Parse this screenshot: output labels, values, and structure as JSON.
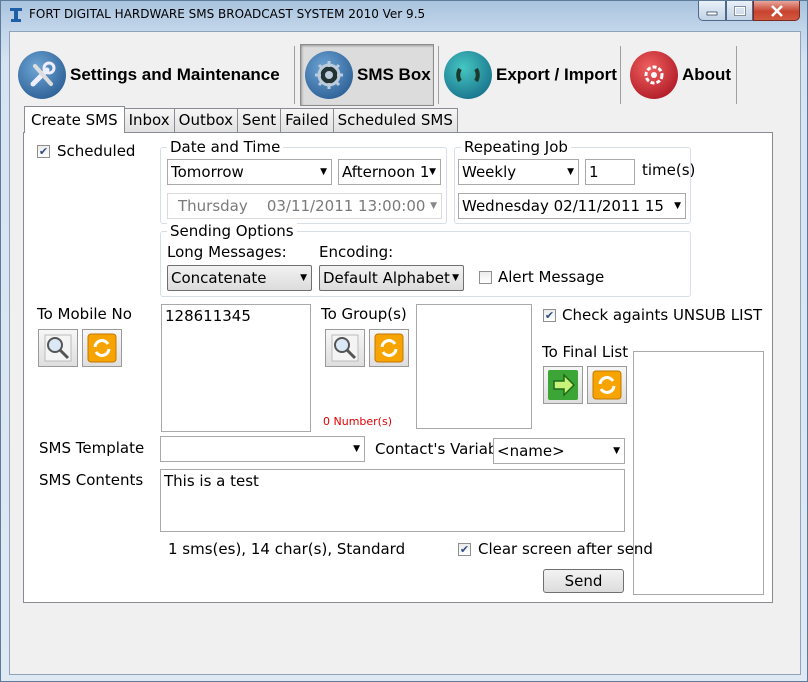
{
  "window": {
    "title": "FORT DIGITAL HARDWARE SMS BROADCAST SYSTEM 2010 Ver 9.5",
    "controls": {
      "minimize": "—",
      "maximize": "☐",
      "close": "✕"
    }
  },
  "nav": {
    "items": [
      {
        "label": "Settings and Maintenance",
        "icon": "tools-icon"
      },
      {
        "label": "SMS Box",
        "icon": "gear-icon"
      },
      {
        "label": "Export / Import",
        "icon": "sync-icon"
      },
      {
        "label": "About",
        "icon": "help-icon"
      }
    ]
  },
  "tabs": [
    "Create SMS",
    "Inbox",
    "Outbox",
    "Sent",
    "Failed",
    "Scheduled SMS"
  ],
  "form": {
    "scheduled_label": "Scheduled",
    "scheduled_checked": true,
    "date_time": {
      "title": "Date and Time",
      "day_value": "Tomorrow",
      "period_value": "Afternoon 1",
      "datetime_value": "Thursday    03/11/2011 13:00:00"
    },
    "repeating": {
      "title": "Repeating Job",
      "frequency_value": "Weekly",
      "times_value": "1",
      "times_label": "time(s)",
      "until_value": "Wednesday  02/11/2011 15"
    },
    "sending_options": {
      "title": "Sending Options",
      "long_messages_label": "Long Messages:",
      "long_messages_value": "Concatenate",
      "encoding_label": "Encoding:",
      "encoding_value": "Default Alphabet",
      "alert_label": "Alert Message",
      "alert_checked": false
    },
    "to_mobile_label": "To Mobile No",
    "mobile_numbers": "128611345",
    "to_groups_label": "To Group(s)",
    "group_count": "0 Number(s)",
    "unsub_label": "Check againts UNSUB LIST",
    "unsub_checked": true,
    "final_list_label": "To Final List",
    "template_label": "SMS Template",
    "template_value": "",
    "contact_var_label": "Contact's Variab",
    "contact_var_value": "<name>",
    "contents_label": "SMS Contents",
    "contents_value": "This is a test",
    "stats": "1 sms(es), 14 char(s), Standard",
    "clear_label": "Clear screen after send",
    "clear_checked": true,
    "send_label": "Send"
  }
}
